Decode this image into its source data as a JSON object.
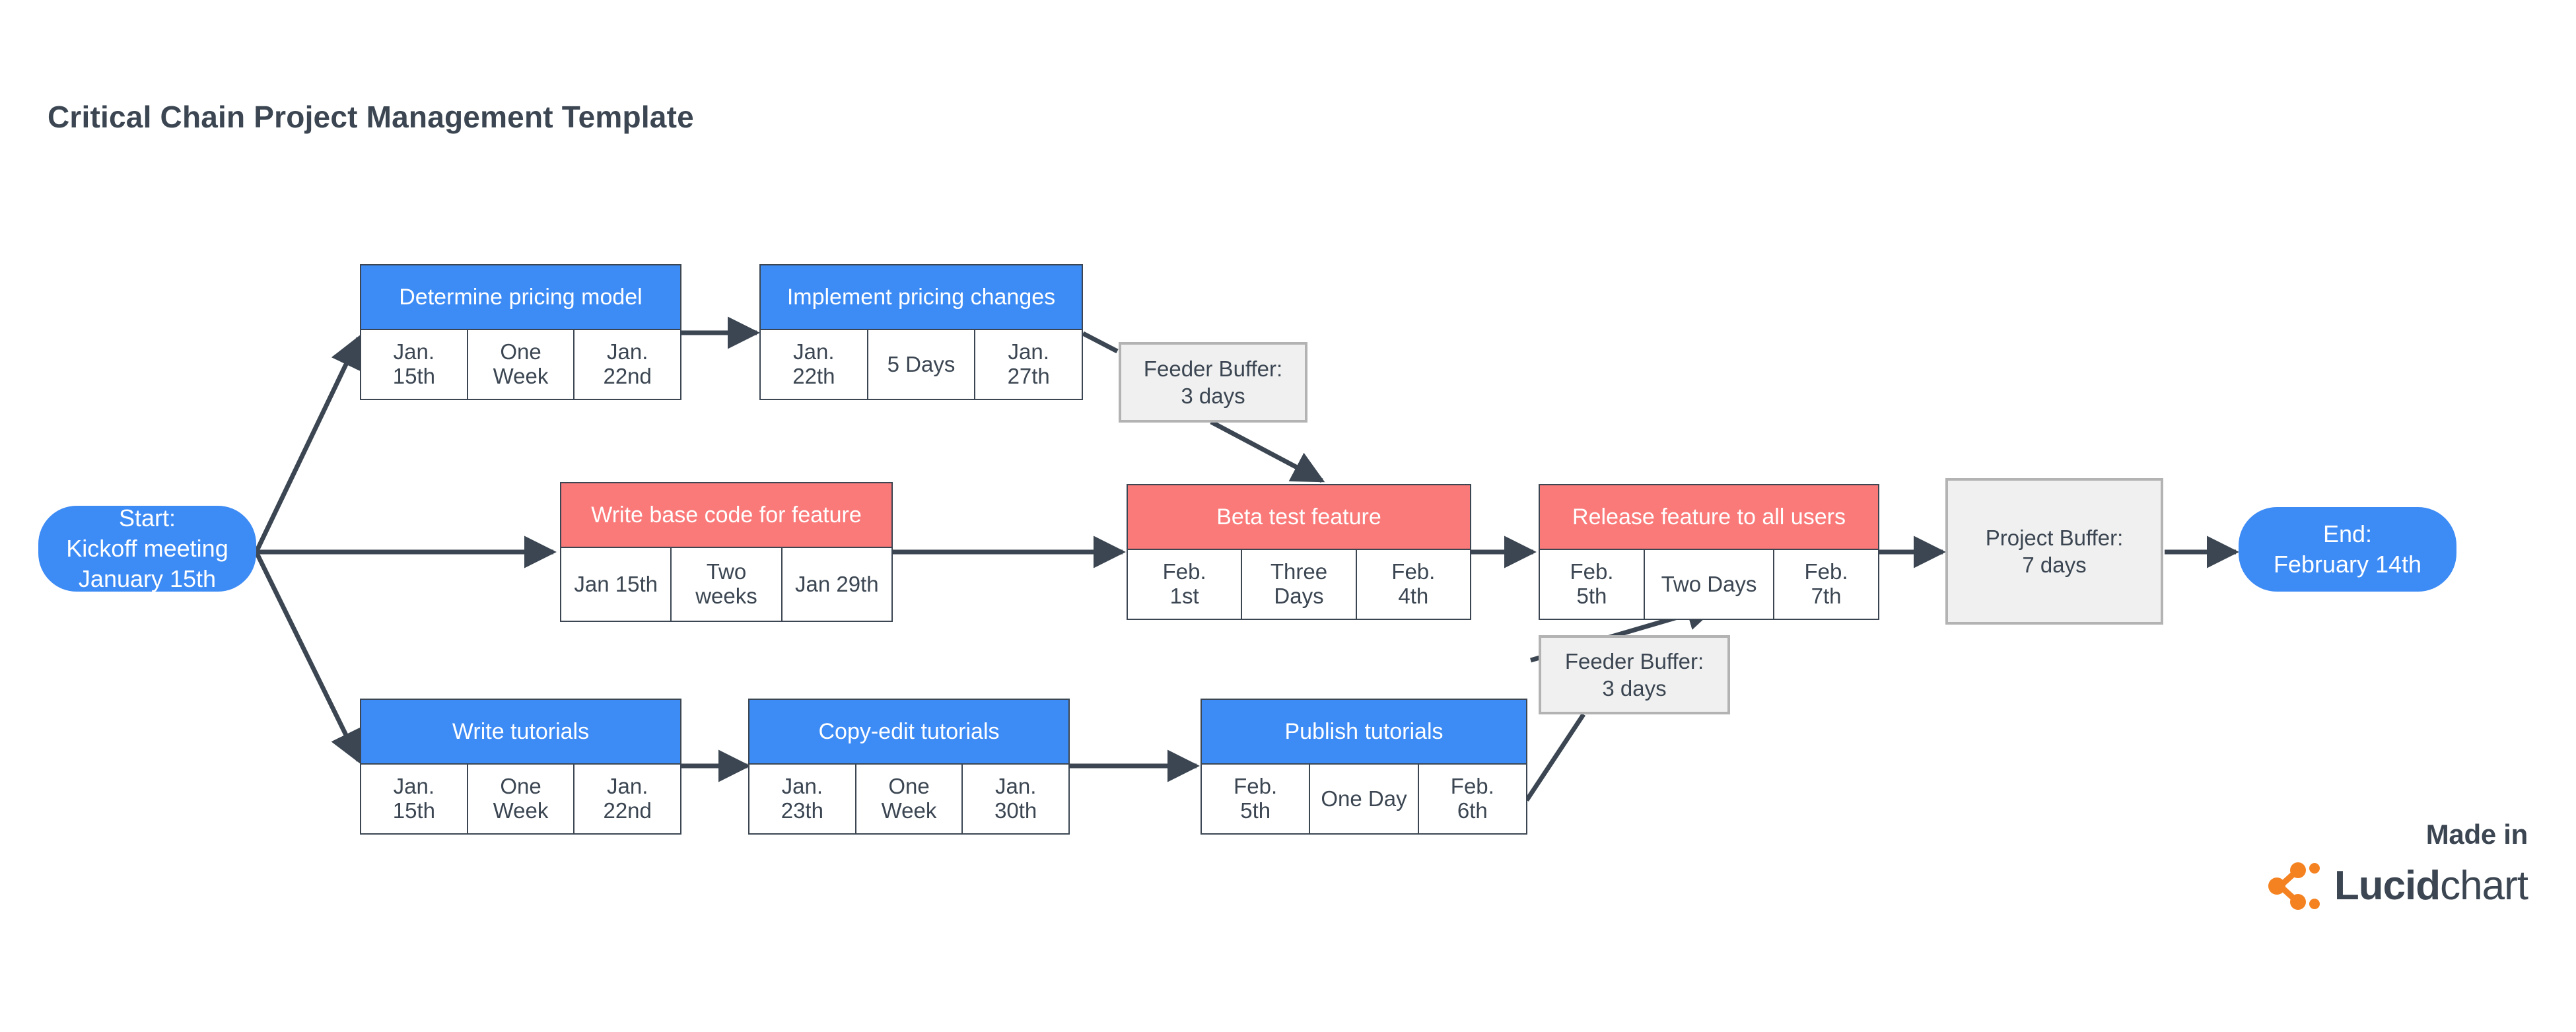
{
  "title": "Critical Chain Project Management Template",
  "colors": {
    "normal_task": "#3d8bf5",
    "critical_task": "#fa7a7a",
    "buffer_fill": "#f0f0f0",
    "buffer_border": "#b3b3b3",
    "line": "#3b4652",
    "text": "#3b4652",
    "brand_orange": "#f58220"
  },
  "start_node": {
    "line1": "Start:",
    "line2": "Kickoff meeting",
    "line3": "January 15th"
  },
  "end_node": {
    "line1": "End:",
    "line2": "February 14th"
  },
  "tasks": [
    {
      "id": "determine-pricing-model",
      "name": "Determine pricing model",
      "critical": false,
      "start": "Jan.\n15th",
      "duration": "One\nWeek",
      "finish": "Jan.\n22nd"
    },
    {
      "id": "implement-pricing-changes",
      "name": "Implement pricing changes",
      "critical": false,
      "start": "Jan.\n22th",
      "duration": "5 Days",
      "finish": "Jan.\n27th"
    },
    {
      "id": "write-base-code-for-feature",
      "name": "Write base code for feature",
      "critical": true,
      "start": "Jan 15th",
      "duration": "Two\nweeks",
      "finish": "Jan 29th"
    },
    {
      "id": "beta-test-feature",
      "name": "Beta test feature",
      "critical": true,
      "start": "Feb.\n1st",
      "duration": "Three\nDays",
      "finish": "Feb.\n4th"
    },
    {
      "id": "release-feature-to-all-users",
      "name": "Release feature to all users",
      "critical": true,
      "start": "Feb.\n5th",
      "duration": "Two Days",
      "finish": "Feb.\n7th"
    },
    {
      "id": "write-tutorials",
      "name": "Write tutorials",
      "critical": false,
      "start": "Jan.\n15th",
      "duration": "One\nWeek",
      "finish": "Jan.\n22nd"
    },
    {
      "id": "copy-edit-tutorials",
      "name": "Copy-edit tutorials",
      "critical": false,
      "start": "Jan.\n23th",
      "duration": "One\nWeek",
      "finish": "Jan.\n30th"
    },
    {
      "id": "publish-tutorials",
      "name": "Publish tutorials",
      "critical": false,
      "start": "Feb.\n5th",
      "duration": "One Day",
      "finish": "Feb.\n6th"
    }
  ],
  "buffers": [
    {
      "id": "feeder-buffer-pricing",
      "label": "Feeder Buffer:\n3 days"
    },
    {
      "id": "feeder-buffer-tutorials",
      "label": "Feeder Buffer:\n3 days"
    },
    {
      "id": "project-buffer",
      "label": "Project Buffer:\n7 days"
    }
  ],
  "branding": {
    "made_in": "Made in",
    "logo_bold": "Lucid",
    "logo_regular": "chart"
  }
}
